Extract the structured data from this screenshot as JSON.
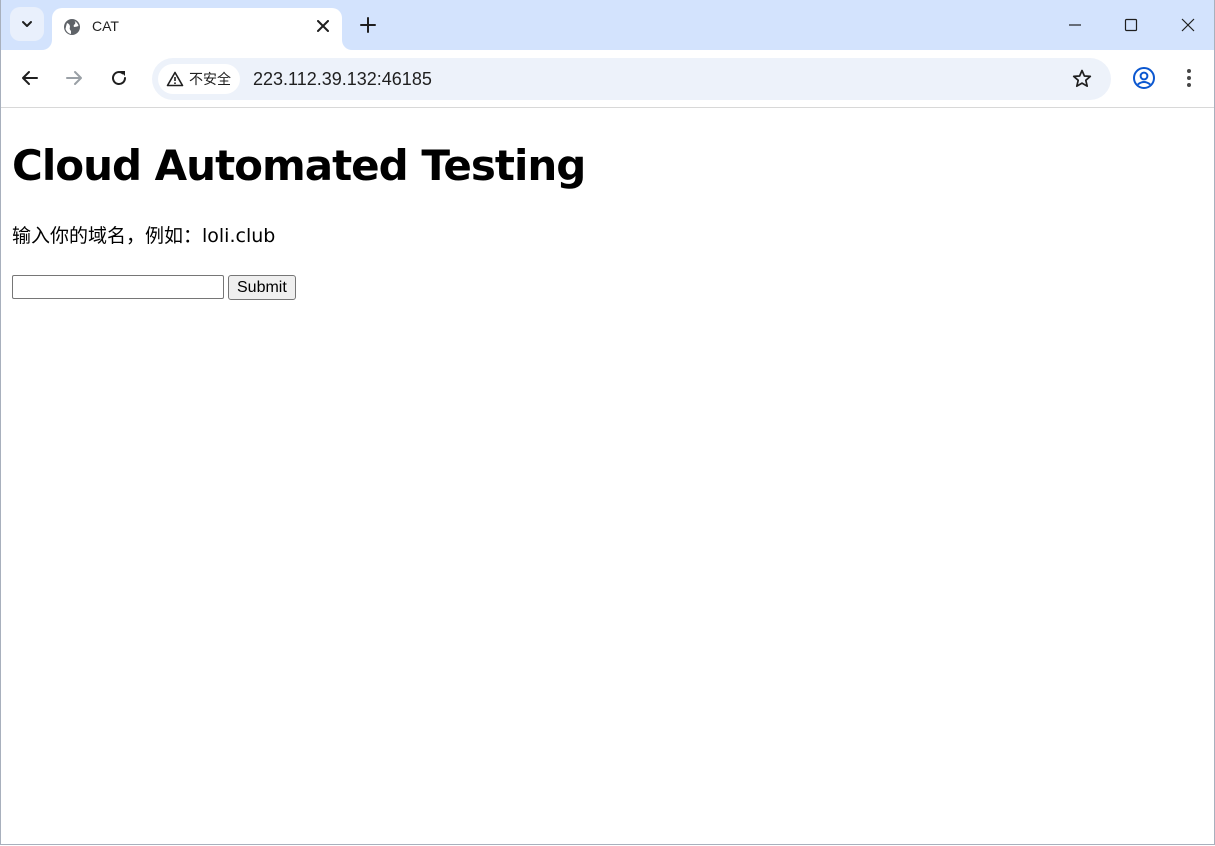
{
  "browser": {
    "tab": {
      "title": "CAT"
    },
    "address_bar": {
      "security_label": "不安全",
      "url": "223.112.39.132:46185"
    }
  },
  "page": {
    "heading": "Cloud Automated Testing",
    "prompt": "输入你的域名，例如：loli.club",
    "form": {
      "input_value": "",
      "submit_label": "Submit"
    }
  },
  "colors": {
    "tabstrip_bg": "#d3e3fd",
    "omnibox_bg": "#edf2fa",
    "profile_accent": "#0b57d0"
  },
  "icons": [
    "tab-search-icon",
    "globe-icon",
    "close-icon",
    "plus-icon",
    "minimize-icon",
    "maximize-icon",
    "window-close-icon",
    "back-icon",
    "forward-icon",
    "reload-icon",
    "warning-icon",
    "star-icon",
    "profile-icon",
    "more-menu-icon"
  ]
}
